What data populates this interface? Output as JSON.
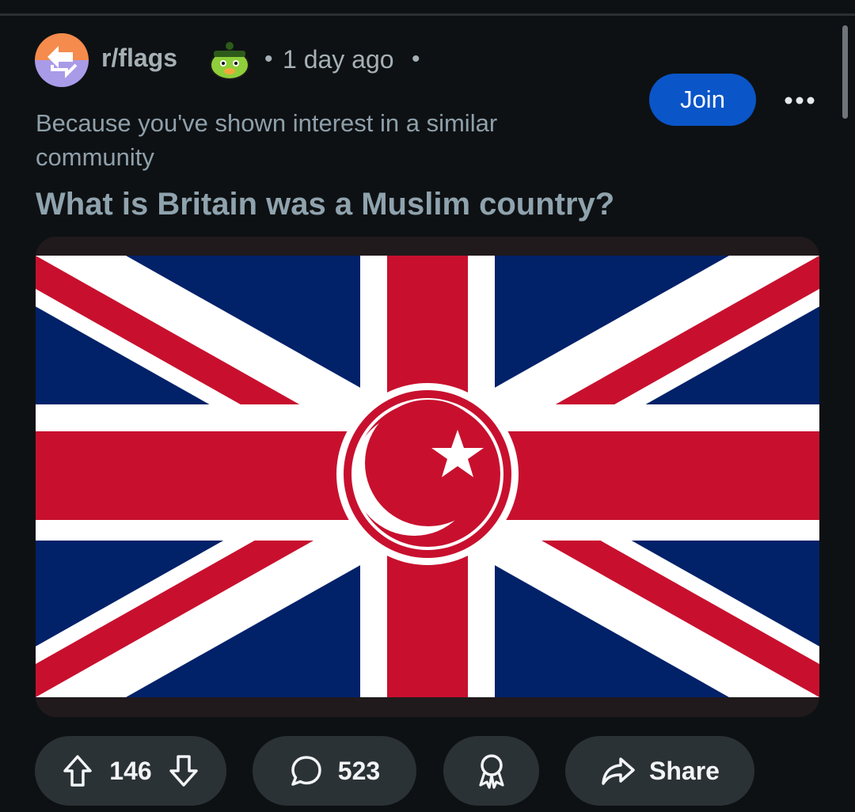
{
  "post": {
    "subreddit": "r/flags",
    "separator": "•",
    "time": "1 day ago",
    "reason": "Because you've shown interest in a similar community",
    "title": "What is Britain was a Muslim country?",
    "join_label": "Join",
    "more_icon": "more-options-icon"
  },
  "actions": {
    "votes": "146",
    "comments": "523",
    "share_label": "Share"
  },
  "colors": {
    "background": "#0e1113",
    "join_button": "#0a55c8",
    "pill": "#2b3236",
    "flag_blue": "#012169",
    "flag_red": "#c8102e",
    "flag_white": "#ffffff"
  },
  "icons": [
    "subreddit-avatar-icon",
    "avatar-mascot-icon",
    "upvote-icon",
    "downvote-icon",
    "comment-icon",
    "award-icon",
    "share-icon"
  ]
}
